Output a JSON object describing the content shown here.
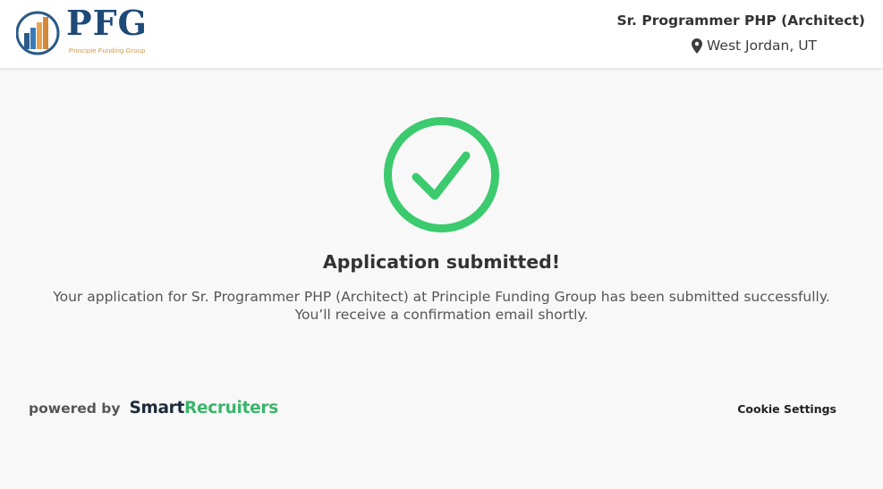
{
  "header": {
    "logo_text": "PFG",
    "logo_subtext": "Principle Funding Group",
    "job_title": "Sr. Programmer PHP (Architect)",
    "job_location": "West Jordan, UT"
  },
  "confirmation": {
    "heading": "Application submitted!",
    "message": "Your application for Sr. Programmer PHP (Architect) at Principle Funding Group has been submitted successfully. You’ll receive a confirmation email shortly.",
    "icon": "check-circle-icon",
    "accent_color": "#3bca6d"
  },
  "footer": {
    "powered_by": "powered by",
    "brand_part1": "Smart",
    "brand_part2": "Recruiters",
    "cookie_settings": "Cookie Settings"
  }
}
